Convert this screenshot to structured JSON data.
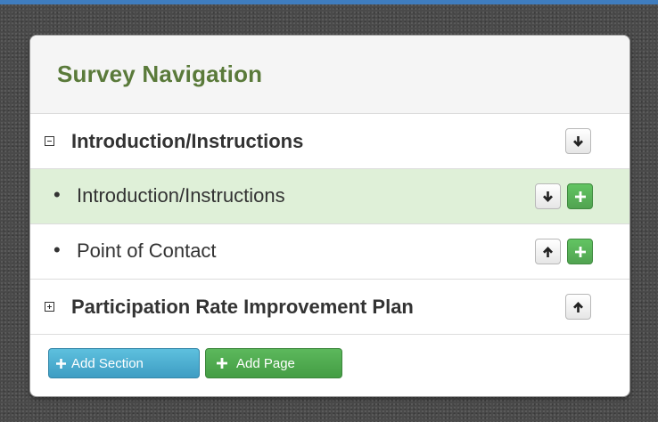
{
  "panel": {
    "title": "Survey Navigation"
  },
  "rows": [
    {
      "kind": "section",
      "label": "Introduction/Instructions",
      "expanded": true,
      "actions": [
        "move-down"
      ]
    },
    {
      "kind": "page",
      "label": "Introduction/Instructions",
      "highlighted": true,
      "actions": [
        "move-down",
        "add"
      ]
    },
    {
      "kind": "page",
      "label": "Point of Contact",
      "actions": [
        "move-up",
        "add"
      ]
    },
    {
      "kind": "section",
      "label": "Participation Rate Improvement Plan",
      "expanded": false,
      "actions": [
        "move-up"
      ]
    }
  ],
  "footer": {
    "add_section_label": "Add Section",
    "add_page_label": "Add Page"
  },
  "colors": {
    "title_green": "#5a7a3a",
    "highlight_row": "#dff0d8",
    "success_button": "#5cb85c",
    "info_button": "#5bc0de",
    "top_bar": "#3f7dbf"
  },
  "icons": [
    "collapse-icon",
    "expand-icon",
    "arrow-down-icon",
    "arrow-up-icon",
    "plus-icon"
  ]
}
